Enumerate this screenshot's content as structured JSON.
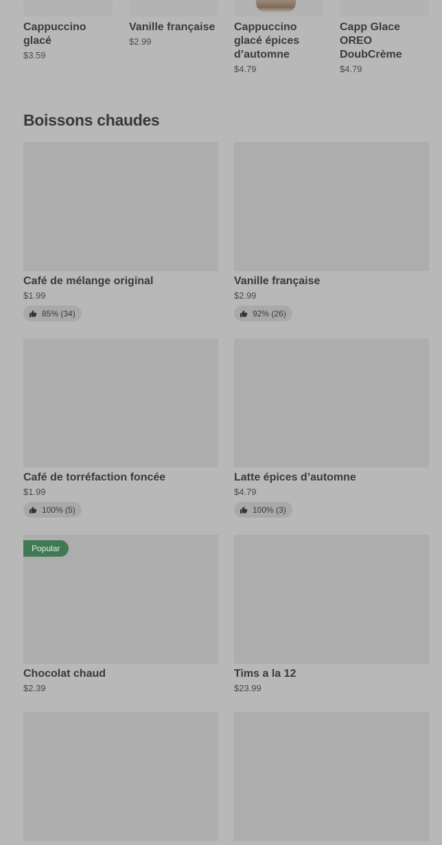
{
  "carousel": [
    {
      "name": "Cappuccino glacé",
      "price": "$3.59"
    },
    {
      "name": "Vanille française",
      "price": "$2.99"
    },
    {
      "name": "Cappuccino glacé épices d’automne",
      "price": "$4.79"
    },
    {
      "name": "Capp Glace OREO DoubCrème",
      "price": "$4.79"
    }
  ],
  "section": {
    "title": "Boissons chaudes"
  },
  "products": [
    {
      "name": "Café de mélange original",
      "price": "$1.99",
      "rating": "85% (34)"
    },
    {
      "name": "Vanille française",
      "price": "$2.99",
      "rating": "92% (26)"
    },
    {
      "name": "Café de torréfaction foncée",
      "price": "$1.99",
      "rating": "100% (5)"
    },
    {
      "name": "Latte épices d’automne",
      "price": "$4.79",
      "rating": "100% (3)"
    },
    {
      "name": "Chocolat chaud",
      "price": "$2.39",
      "badge": "Popular"
    },
    {
      "name": "Tims a la 12",
      "price": "$23.99"
    }
  ],
  "colors": {
    "overlay": "#b8b8b8",
    "badge": "#3f7a55"
  }
}
